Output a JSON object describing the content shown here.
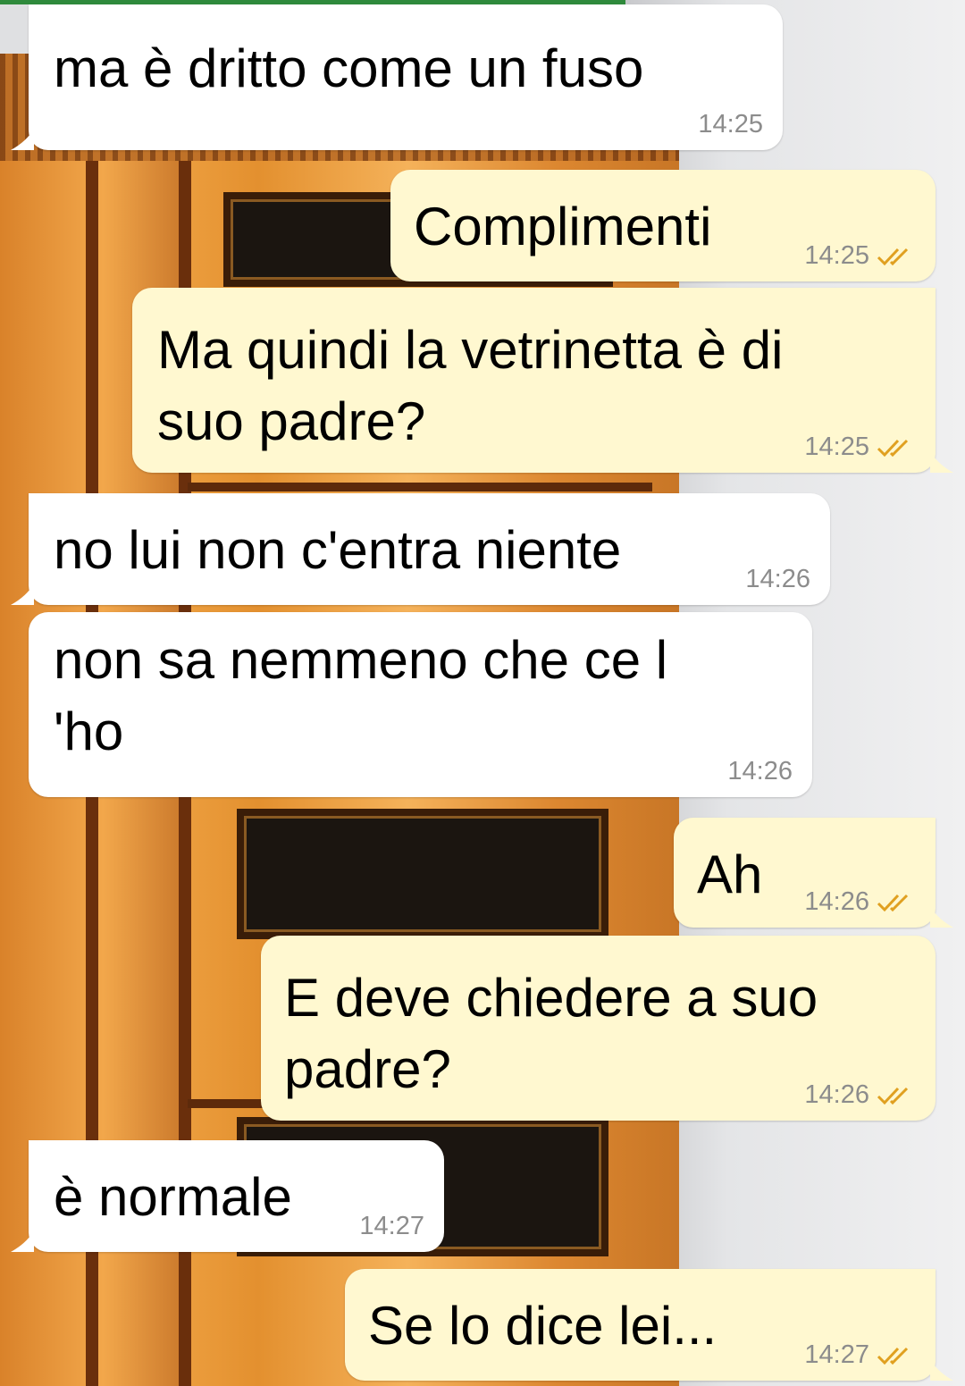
{
  "colors": {
    "incoming_bubble": "#ffffff",
    "outgoing_bubble": "#fff8d0",
    "timestamp": "#8c8c8c",
    "read_check": "#e0a020"
  },
  "messages": [
    {
      "direction": "in",
      "lines": [
        "ma è dritto come un fuso"
      ],
      "time": "14:25"
    },
    {
      "direction": "out",
      "lines": [
        "Complimenti"
      ],
      "time": "14:25",
      "status_icon": "double-check-icon"
    },
    {
      "direction": "out",
      "lines": [
        "Ma quindi la vetrinetta è di",
        "suo padre?"
      ],
      "time": "14:25",
      "status_icon": "double-check-icon"
    },
    {
      "direction": "in",
      "lines": [
        "no lui non c'entra niente"
      ],
      "time": "14:26"
    },
    {
      "direction": "in",
      "lines": [
        "non sa nemmeno che ce l",
        "'ho"
      ],
      "time": "14:26"
    },
    {
      "direction": "out",
      "lines": [
        "Ah"
      ],
      "time": "14:26",
      "status_icon": "double-check-icon"
    },
    {
      "direction": "out",
      "lines": [
        "E deve chiedere a suo",
        "padre?"
      ],
      "time": "14:26",
      "status_icon": "double-check-icon"
    },
    {
      "direction": "in",
      "lines": [
        "è normale"
      ],
      "time": "14:27"
    },
    {
      "direction": "out",
      "lines": [
        "Se lo dice lei..."
      ],
      "time": "14:27",
      "status_icon": "double-check-icon"
    }
  ]
}
